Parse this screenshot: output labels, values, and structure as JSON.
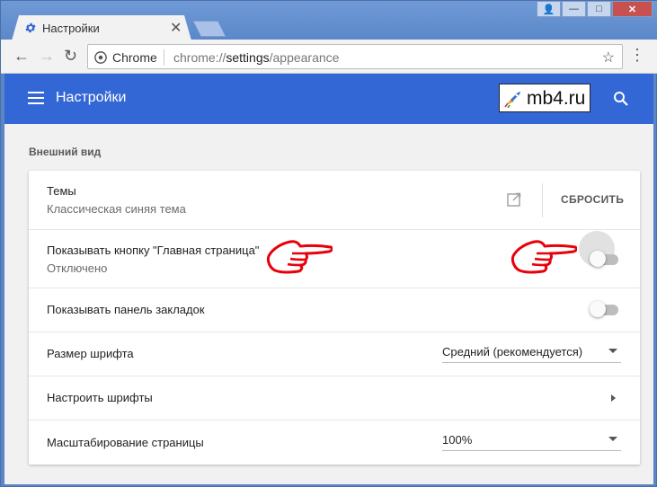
{
  "window": {
    "tab_title": "Настройки",
    "tab_close": "✕",
    "min_label": "—",
    "max_label": "□",
    "close_label": "✕",
    "user_label": "👤"
  },
  "toolbar": {
    "back": "←",
    "forward": "→",
    "reload": "↻",
    "omnibox_label": "Chrome",
    "url_prefix": "chrome://",
    "url_host": "settings",
    "url_path": "/appearance",
    "star": "☆",
    "menu": "⋮"
  },
  "header": {
    "title": "Настройки",
    "logo_text": "mb4.ru"
  },
  "section": {
    "title": "Внешний вид"
  },
  "rows": {
    "theme": {
      "label": "Темы",
      "sub": "Классическая синяя тема",
      "reset": "СБРОСИТЬ"
    },
    "home_button": {
      "label": "Показывать кнопку \"Главная страница\"",
      "sub": "Отключено",
      "enabled": false
    },
    "bookmarks_bar": {
      "label": "Показывать панель закладок",
      "enabled": false
    },
    "font_size": {
      "label": "Размер шрифта",
      "value": "Средний (рекомендуется)"
    },
    "customize_fonts": {
      "label": "Настроить шрифты"
    },
    "page_zoom": {
      "label": "Масштабирование страницы",
      "value": "100%"
    }
  },
  "colors": {
    "titlebar": "#5b88c9",
    "settings_header": "#3367d6",
    "page_bg": "#f1f1f1",
    "annotation": "#e8000a"
  }
}
